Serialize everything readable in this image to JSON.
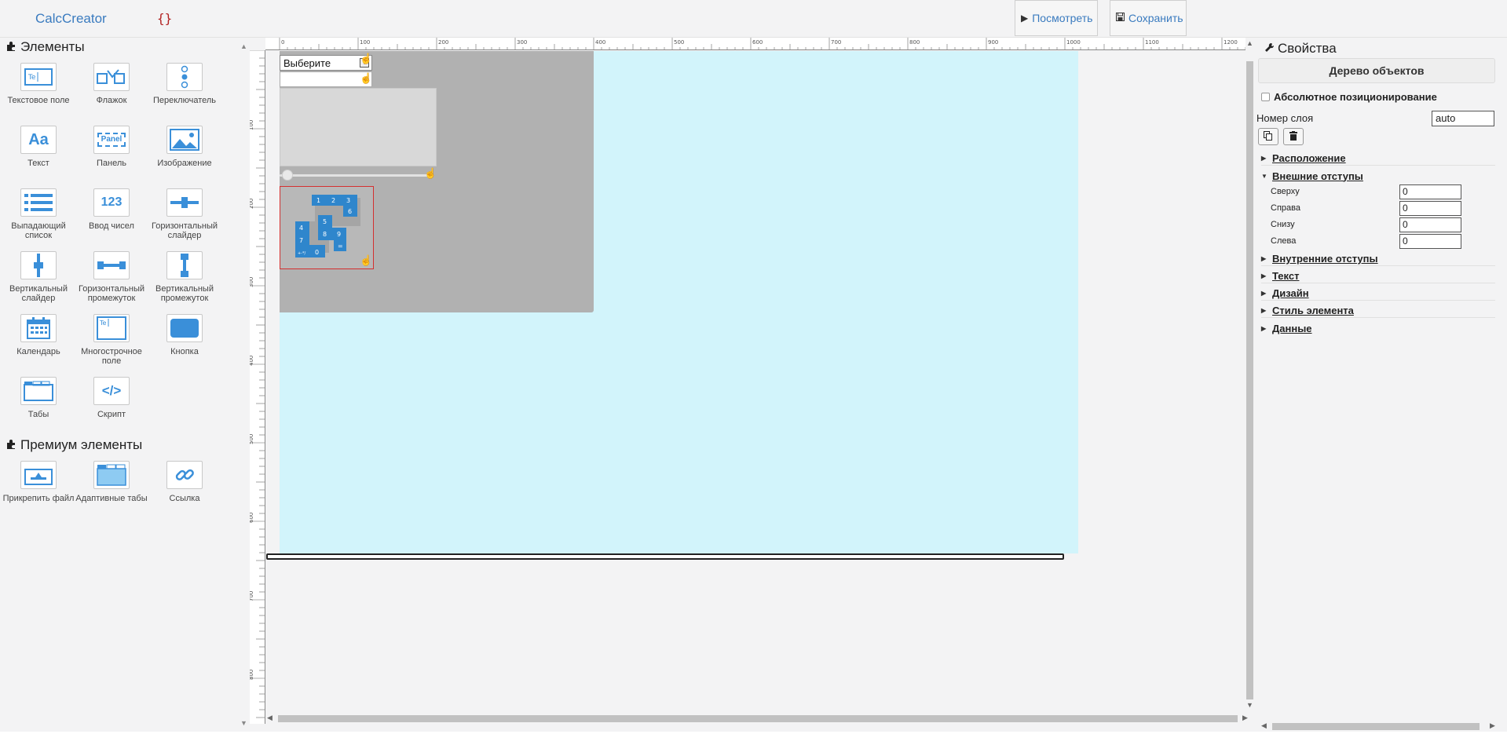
{
  "header": {
    "logo": "CalcCreator",
    "json_icon": "{}",
    "preview_label": "Посмотреть",
    "save_label": "Сохранить"
  },
  "palette": {
    "title": "Элементы",
    "tools": [
      {
        "label": "Текстовое поле",
        "icon": "text-field-icon"
      },
      {
        "label": "Флажок",
        "icon": "checkbox-icon"
      },
      {
        "label": "Переключатель",
        "icon": "radio-icon"
      },
      {
        "label": "Текст",
        "icon": "text-icon",
        "glyph": "Aa"
      },
      {
        "label": "Панель",
        "icon": "panel-icon",
        "glyph": "Panel"
      },
      {
        "label": "Изображение",
        "icon": "image-icon"
      },
      {
        "label": "Выпадающий список",
        "icon": "dropdown-icon"
      },
      {
        "label": "Ввод чисел",
        "icon": "number-input-icon",
        "glyph": "123"
      },
      {
        "label": "Горизонтальный слайдер",
        "icon": "hslider-icon"
      },
      {
        "label": "Вертикальный слайдер",
        "icon": "vslider-icon"
      },
      {
        "label": "Горизонтальный промежуток",
        "icon": "hspacer-icon"
      },
      {
        "label": "Вертикальный промежуток",
        "icon": "vspacer-icon"
      },
      {
        "label": "Календарь",
        "icon": "calendar-icon"
      },
      {
        "label": "Многострочное поле",
        "icon": "textarea-icon"
      },
      {
        "label": "Кнопка",
        "icon": "button-icon"
      },
      {
        "label": "Табы",
        "icon": "tabs-icon"
      },
      {
        "label": "Скрипт",
        "icon": "script-icon",
        "glyph": "</>"
      }
    ],
    "premium_title": "Премиум элементы",
    "premium_tools": [
      {
        "label": "Прикрепить файл",
        "icon": "attach-file-icon"
      },
      {
        "label": "Адаптивные табы",
        "icon": "adaptive-tabs-icon"
      },
      {
        "label": "Ссылка",
        "icon": "link-icon"
      }
    ]
  },
  "canvas": {
    "ruler_top": [
      "0",
      "100",
      "200",
      "300",
      "400",
      "500",
      "600",
      "700",
      "800",
      "900",
      "1000",
      "1100",
      "1200"
    ],
    "ruler_left": [
      "100",
      "200",
      "300",
      "400",
      "500",
      "600",
      "700",
      "800"
    ],
    "select_value": "Выберите",
    "keypad": [
      "1",
      "2",
      "3",
      "6",
      "5",
      "4",
      "8",
      "9",
      "7",
      "=",
      "0",
      "+-*/"
    ]
  },
  "properties": {
    "title": "Свойства",
    "tree_button": "Дерево объектов",
    "absolute_label": "Абсолютное позиционирование",
    "layer_label": "Номер слоя",
    "layer_value": "auto",
    "sections": {
      "location": "Расположение",
      "margins": "Внешние отступы",
      "padding": "Внутренние отступы",
      "text": "Текст",
      "design": "Дизайн",
      "style": "Стиль элемента",
      "data": "Данные"
    },
    "margins": [
      {
        "label": "Сверху",
        "value": "0"
      },
      {
        "label": "Справа",
        "value": "0"
      },
      {
        "label": "Снизу",
        "value": "0"
      },
      {
        "label": "Слева",
        "value": "0"
      }
    ]
  }
}
